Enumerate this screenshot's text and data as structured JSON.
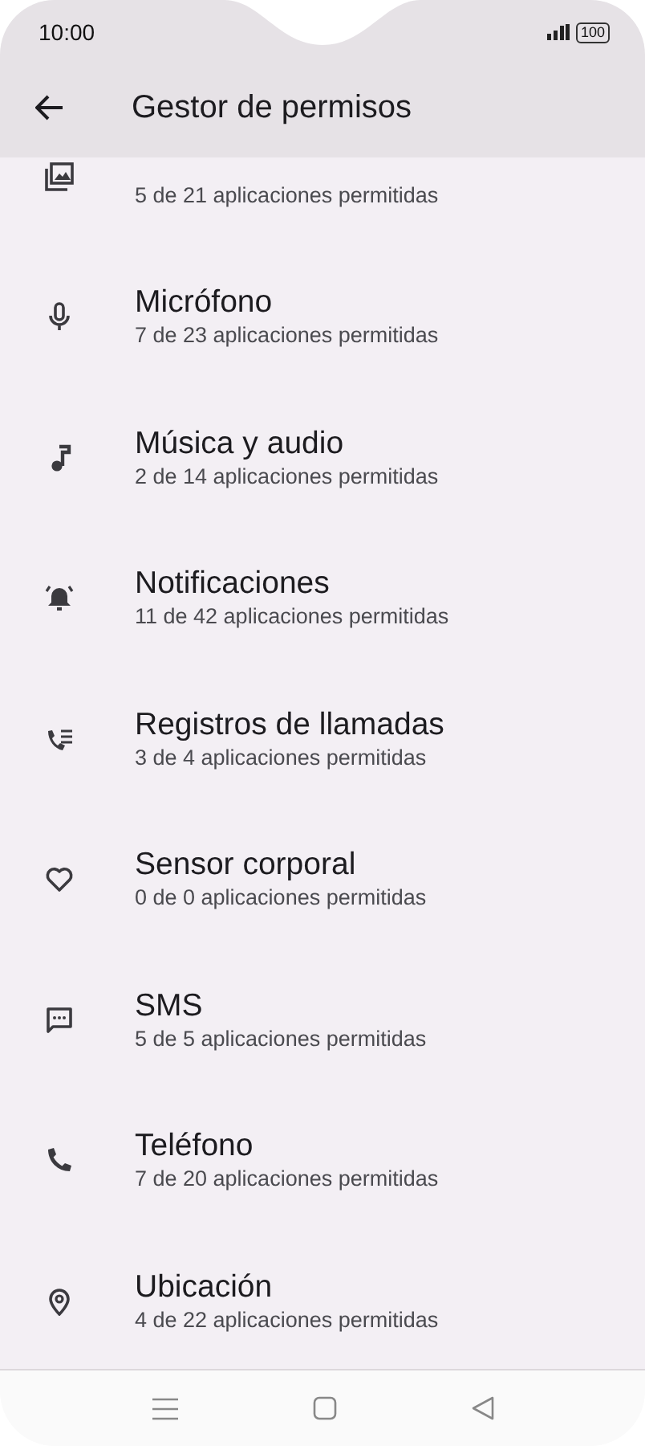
{
  "status_bar": {
    "time": "10:00",
    "battery": "100"
  },
  "header": {
    "title": "Gestor de permisos"
  },
  "permissions": [
    {
      "subtitle": "5 de 21 aplicaciones permitidas"
    },
    {
      "title": "Micrófono",
      "subtitle": "7 de 23 aplicaciones permitidas"
    },
    {
      "title": "Música y audio",
      "subtitle": "2 de 14 aplicaciones permitidas"
    },
    {
      "title": "Notificaciones",
      "subtitle": "11 de 42 aplicaciones permitidas"
    },
    {
      "title": "Registros de llamadas",
      "subtitle": "3 de 4 aplicaciones permitidas"
    },
    {
      "title": "Sensor corporal",
      "subtitle": "0 de 0 aplicaciones permitidas"
    },
    {
      "title": "SMS",
      "subtitle": "5 de 5 aplicaciones permitidas"
    },
    {
      "title": "Teléfono",
      "subtitle": "7 de 20 aplicaciones permitidas"
    },
    {
      "title": "Ubicación",
      "subtitle": "4 de 22 aplicaciones permitidas"
    }
  ]
}
